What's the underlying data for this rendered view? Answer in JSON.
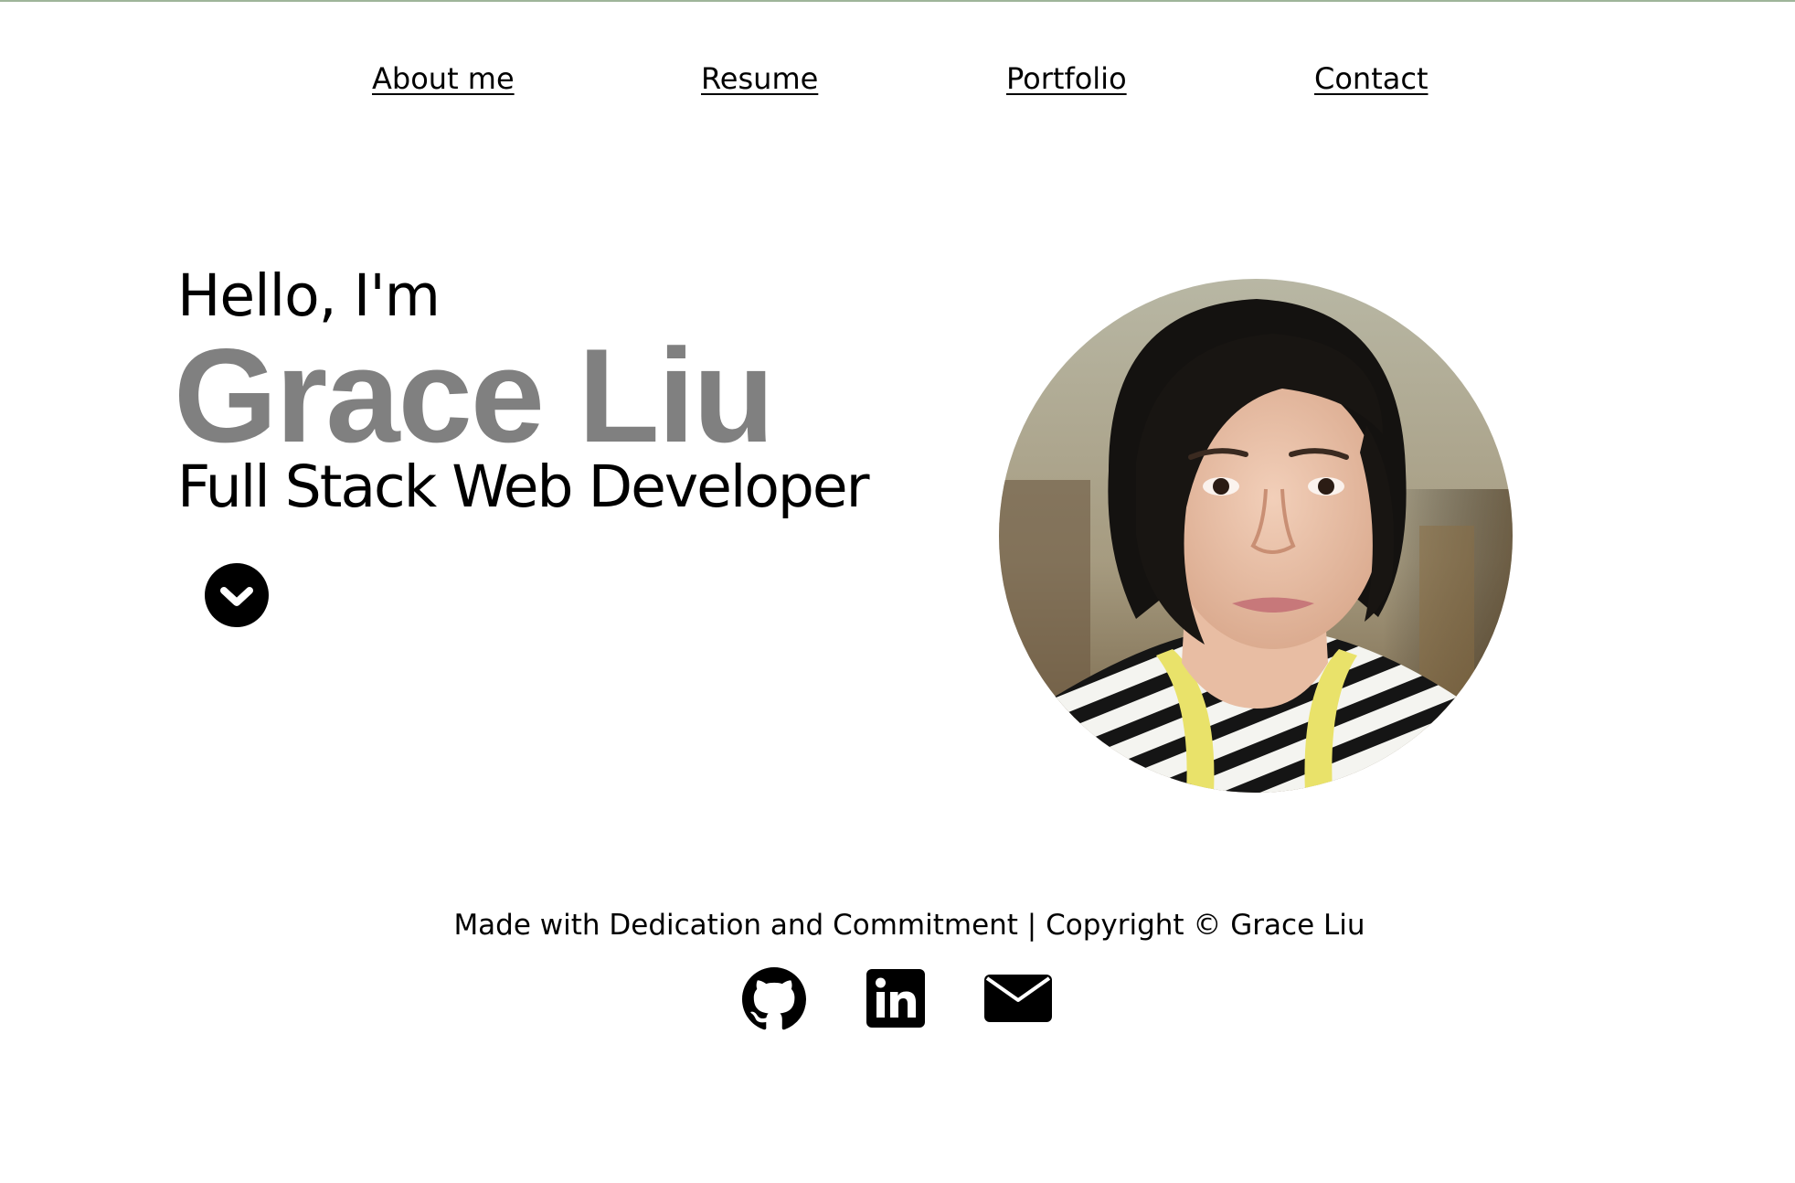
{
  "nav": {
    "items": [
      {
        "label": "About me"
      },
      {
        "label": "Resume"
      },
      {
        "label": "Portfolio"
      },
      {
        "label": "Contact"
      }
    ]
  },
  "hero": {
    "greeting": "Hello, I'm",
    "name": "Grace Liu",
    "role": "Full Stack Web Developer",
    "scroll_icon": "chevron-down-circle-icon",
    "avatar_alt": "Grace Liu"
  },
  "footer": {
    "text": "Made with Dedication and Commitment | Copyright © Grace Liu",
    "social": [
      {
        "icon": "github-icon"
      },
      {
        "icon": "linkedin-icon"
      },
      {
        "icon": "email-icon"
      }
    ]
  },
  "colors": {
    "name_gray": "#808080",
    "text": "#000000",
    "background": "#ffffff",
    "top_rule": "#9fb59a"
  }
}
